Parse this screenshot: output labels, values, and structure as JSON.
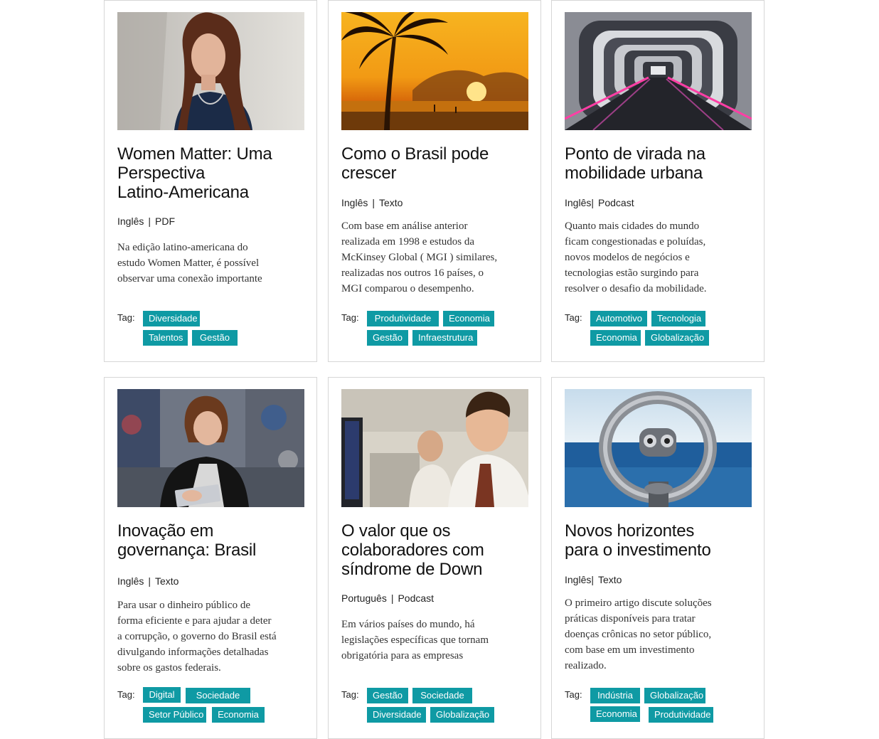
{
  "tag_label": "Tag:",
  "colors": {
    "tag_bg": "#0f9aa4",
    "border": "#d6d6d6"
  },
  "cards": [
    {
      "title_lines": [
        "Women Matter: Uma",
        "Perspectiva",
        "Latino-Americana"
      ],
      "language": "Inglês",
      "format": "PDF",
      "description_lines": [
        "Na edição latino-americana do",
        "estudo Women Matter, é possível",
        "observar uma conexão importante"
      ],
      "tags": [
        "Diversidade",
        "Talentos",
        "Gestão"
      ],
      "image": "woman-portrait"
    },
    {
      "title_lines": [
        "Como o Brasil pode",
        "crescer"
      ],
      "language": "Inglês",
      "format": "Texto",
      "description_lines": [
        "Com base em análise anterior",
        "realizada em 1998 e estudos da",
        "McKinsey Global ( MGI ) similares,",
        "realizadas nos outros 16 países, o",
        "MGI comparou o desempenho."
      ],
      "tags": [
        "Produtividade",
        "Economia",
        "Gestão",
        "Infraestrutura"
      ],
      "image": "palm-sunset"
    },
    {
      "title_lines": [
        "Ponto de virada na",
        "mobilidade urbana"
      ],
      "language": "Inglês",
      "format": "Podcast",
      "description_lines": [
        "Quanto mais cidades do mundo",
        "ficam congestionadas e poluídas,",
        "novos modelos de negócios e",
        "tecnologias estão surgindo para",
        "resolver o desafio da mobilidade."
      ],
      "tags": [
        "Automotivo",
        "Tecnologia",
        "Economia",
        "Globalização"
      ],
      "image": "tunnel-walkway"
    },
    {
      "title_lines": [
        "Inovação em",
        "governança: Brasil"
      ],
      "language": "Inglês",
      "format": "Texto",
      "description_lines": [
        "Para usar o dinheiro público de",
        "forma eficiente e para ajudar a deter",
        "a corrupção, o governo do Brasil está",
        "divulgando informações detalhadas",
        "sobre os gastos federais."
      ],
      "tags": [
        "Digital",
        "Sociedade",
        "Setor Público",
        "Economia"
      ],
      "image": "woman-tablet"
    },
    {
      "title_lines": [
        "O valor que os",
        "colaboradores com",
        "síndrome de Down"
      ],
      "language": "Português",
      "format": "Podcast",
      "description_lines": [
        "Em vários países do mundo, há",
        "legislações específicas que tornam",
        "obrigatória para as empresas"
      ],
      "tags": [
        "Gestão",
        "Sociedade",
        "Diversidade",
        "Globalização"
      ],
      "image": "office-worker"
    },
    {
      "title_lines": [
        "Novos horizontes",
        "para o investimento"
      ],
      "language": "Inglês",
      "format": "Texto",
      "description_lines": [
        "O primeiro artigo discute soluções",
        "práticas disponíveis para tratar",
        "doenças crônicas no setor público,",
        "com base em um investimento",
        "realizado."
      ],
      "tags": [
        "Indústria",
        "Globalização",
        "Economia",
        "Produtividade"
      ],
      "image": "binocular-viewer"
    }
  ]
}
